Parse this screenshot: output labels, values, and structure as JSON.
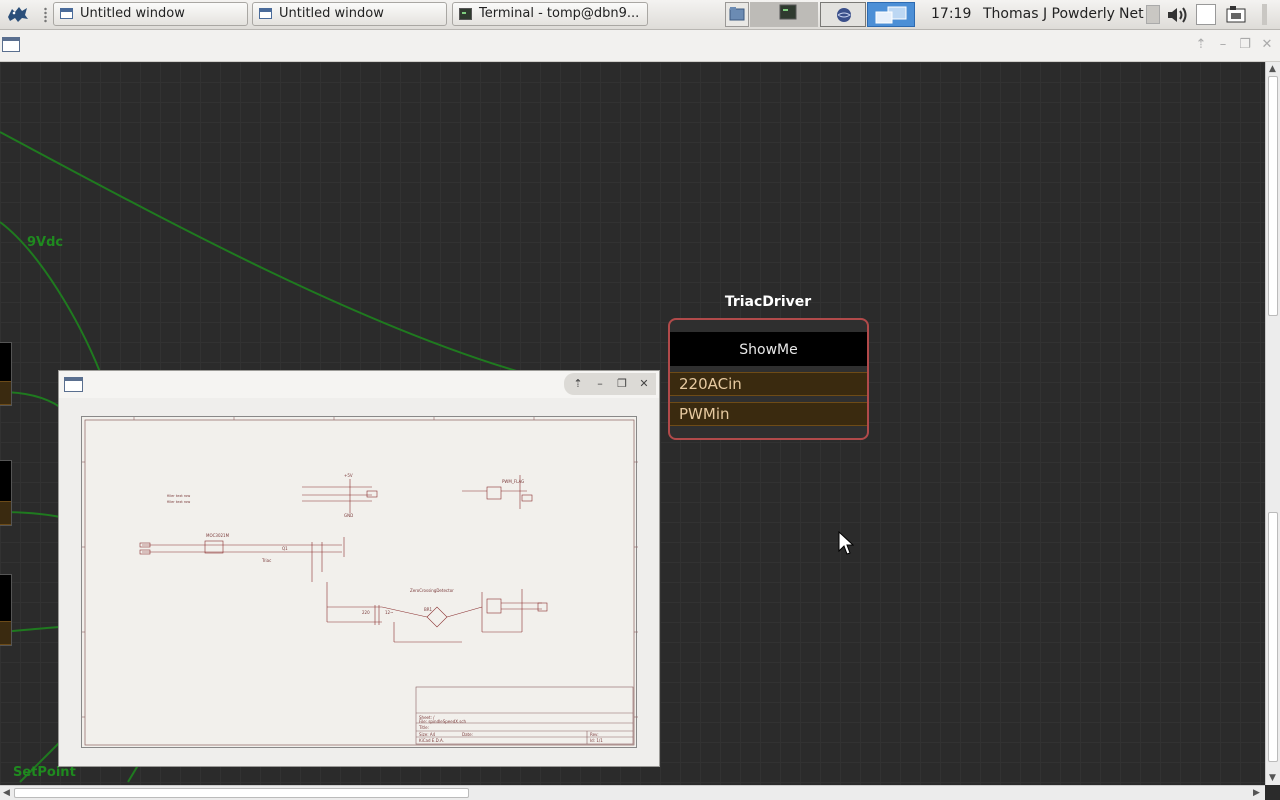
{
  "taskbar": {
    "windows": [
      {
        "label": "Untitled window",
        "icon": "window-icon"
      },
      {
        "label": "Untitled window",
        "icon": "window-icon"
      },
      {
        "label": "Terminal - tomp@dbn9...",
        "icon": "terminal-icon"
      }
    ],
    "clock": "17:19",
    "user": "Thomas J Powderly",
    "net_label": "Net"
  },
  "canvas": {
    "wire_labels": [
      "9Vdc",
      "SetPoint"
    ],
    "node": {
      "title": "TriacDriver",
      "header": "ShowMe",
      "ports": [
        "220ACin",
        "PWMin"
      ],
      "border_color": "#b14a4a"
    },
    "wire_color": "#1f7a1f"
  },
  "schematic": {
    "labels": [
      "ZeroCrossingDetector",
      "BR1",
      "220",
      "12~",
      "Q1",
      "MOC3021M",
      "Triac",
      "+5V",
      "GND",
      "PWM_FLAG",
      "Sheet: /",
      "File: spindleSpeedX.sch",
      "Title:",
      "Size: A4",
      "Date:",
      "Rev:",
      "KiCad E.D.A.",
      "Id: 1/1"
    ]
  }
}
